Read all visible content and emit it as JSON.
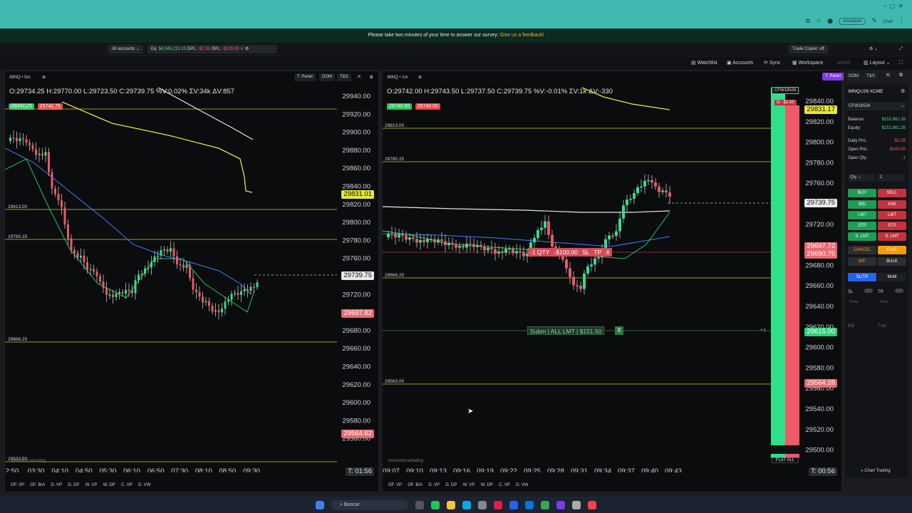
{
  "browser": {
    "update_label": "Actualizar",
    "chat_label": "Chat"
  },
  "survey": {
    "text": "Please take two minutes of your time to answer our survey:",
    "link": "Give us a feedback!"
  },
  "toolbar": {
    "accounts_select": "All accounts",
    "eq_label": "Eq:",
    "eq_value": "$4,345,215.15",
    "dpl_label": "DPL:",
    "dpl_value": "-$2.55",
    "opl_label": "OPL:",
    "opl_value": "-$103.00",
    "trade_copier": "Trade Copier: off"
  },
  "workspace_bar": {
    "watchlist": "Watchlist",
    "accounts": "Accounts",
    "sync": "Sync",
    "workspace": "Workspace",
    "workspace_name": "work2",
    "layout": "Layout"
  },
  "left_chart": {
    "symbol": "/MNQ",
    "timeframe": "5m",
    "btn_tpanel": "T. Panel",
    "btn_dom": "DOM",
    "btn_ts": "T&S",
    "ohlc": "O:29734.25  H:29770.00  L:29723.50  C:29739.75  %V:0.02%  ΣV:34k  ΔV:857",
    "bid_badge": "29741.25",
    "ask_badge": "29740.75",
    "level_mid": "29924.25",
    "y_ticks": [
      "29940.00",
      "29920.00",
      "29900.00",
      "29880.00",
      "29860.00",
      "29840.00",
      "29820.00",
      "29800.00",
      "29780.00",
      "29760.00",
      "29740.00",
      "29720.00",
      "29700.00",
      "29680.00",
      "29660.00",
      "29640.00",
      "29620.00",
      "29600.00",
      "29580.00",
      "29560.00"
    ],
    "x_ticks": [
      "2:50",
      "03:30",
      "04:10",
      "04:50",
      "05:30",
      "06:10",
      "06:50",
      "07:30",
      "08:10",
      "08:50",
      "09:30"
    ],
    "levels": [
      "29813.00",
      "29780.25",
      "29666.25",
      "29533.50"
    ],
    "tag_yellow": "29831.01",
    "tag_price": "29739.75",
    "tag_red1": "29697.82",
    "tag_red2": "29564.62",
    "timer": "T: 01:56",
    "watermark": "volumetricatrading",
    "footer": [
      "OF. VP",
      "OF. B/A",
      "D. VP",
      "D. DP",
      "W. VP",
      "W. DP",
      "C. VP",
      "D. VW"
    ]
  },
  "right_chart": {
    "symbol": "/MNQ",
    "timeframe": "1m",
    "btn_tpanel": "T. Panel",
    "btn_dom": "DOM",
    "btn_ts": "T&S",
    "ohlc": "O:29742.00  H:29743.50  L:29737.50  C:29739.75  %V:-0.01%  ΣV:1k  ΔV:-330",
    "bid_badge": "29740.50",
    "ask_badge": "29740.00",
    "y_ticks": [
      "29840.00",
      "29820.00",
      "29800.00",
      "29780.00",
      "29760.00",
      "29740.00",
      "29720.00",
      "29700.00",
      "29680.00",
      "29660.00",
      "29640.00",
      "29620.00",
      "29600.00",
      "29580.00",
      "29560.00",
      "29540.00",
      "29520.00",
      "29500.00"
    ],
    "x_ticks": [
      "09:07",
      "09:10",
      "09:13",
      "09:16",
      "09:19",
      "09:22",
      "09:25",
      "09:28",
      "09:31",
      "09:34",
      "09:37",
      "09:40",
      "09:43"
    ],
    "levels": [
      "29813.00",
      "29780.25",
      "29666.25",
      "29563.00"
    ],
    "tag_yellow": "29831.17",
    "tag_price": "29739.75",
    "tag_red1": "29697.72",
    "tag_red2": "29690.75",
    "tag_green": "29615.00",
    "tag_red3": "29564.28",
    "position_label": "-1 QTY",
    "position_pnl": "-$100.00",
    "sl_btn": "SL",
    "tp_btn": "TP",
    "close_btn": "X",
    "order_label": "Subm | ALL LMT | $151.50",
    "order_close": "X",
    "order_qty": "+1",
    "account_chip": "CFW18526",
    "pnl_chip": "D: -$2.55",
    "timer": "T: 00:56",
    "flat_all": "FLAT ALL",
    "watermark": "volumetricatrading",
    "footer": [
      "OF. VP",
      "OF. B/A",
      "D. VP",
      "D. DP",
      "W. VP",
      "W. DP",
      "C. VP",
      "D. VW"
    ]
  },
  "trade_panel": {
    "symbol": "/MNQU26:XCME",
    "account": "CFW18526",
    "rows": [
      {
        "label": "Balance:",
        "value": "$152,861.35"
      },
      {
        "label": "Equity:",
        "value": "$152,861.35"
      },
      {
        "label": "Daily PnL:",
        "value": "-$2.55"
      },
      {
        "label": "Open PnL:",
        "value": "-$100.00"
      },
      {
        "label": "Open Qty:",
        "value": "-1"
      }
    ],
    "qty_label": "Qty",
    "qty_value": "1",
    "buttons_left": [
      "BUY",
      "BID",
      "LMT",
      "STP",
      "S. LMT"
    ],
    "buttons_right": [
      "SELL",
      "ASK",
      "LMT",
      "STP",
      "S. LMT"
    ],
    "cancel": "CANCEL",
    "flat": "FLAT",
    "be": "B/E",
    "bulk": "BULK",
    "tab_sltp": "SL/TP",
    "tab_multi": "Multi",
    "sl": "SL",
    "tp": "TP.",
    "ticks": "Ticks",
    "be_label": "B/E",
    "trail": "Trail.",
    "chart_trading": "Chart Trading"
  },
  "taskbar": {
    "search": "Buscar"
  }
}
